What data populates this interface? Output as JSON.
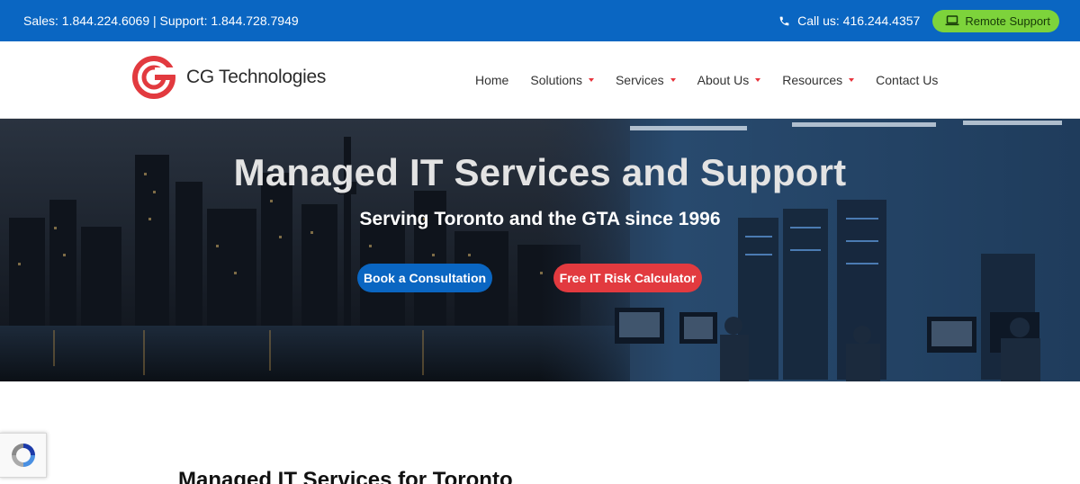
{
  "topbar": {
    "contact_text": "Sales: 1.844.224.6069 | Support: 1.844.728.7949",
    "call_text": "Call us: 416.244.4357",
    "remote_support_label": "Remote Support"
  },
  "header": {
    "logo_text": "CG Technologies",
    "nav": [
      {
        "label": "Home",
        "has_dropdown": false
      },
      {
        "label": "Solutions",
        "has_dropdown": true
      },
      {
        "label": "Services",
        "has_dropdown": true
      },
      {
        "label": "About Us",
        "has_dropdown": true
      },
      {
        "label": "Resources",
        "has_dropdown": true
      },
      {
        "label": "Contact Us",
        "has_dropdown": false
      }
    ]
  },
  "hero": {
    "title": "Managed IT Services and Support",
    "subtitle": "Serving Toronto and the GTA since 1996",
    "primary_button": "Book a Consultation",
    "secondary_button": "Free IT Risk Calculator"
  },
  "main": {
    "section_title": "Managed IT Services for Toronto"
  },
  "icons": {
    "phone": "phone-icon",
    "laptop": "laptop-icon",
    "logo": "cg-logo-icon",
    "recaptcha": "recaptcha-icon"
  },
  "colors": {
    "topbar": "#0a66c2",
    "accent_red": "#e23a3f",
    "remote_green": "#7dd33b"
  }
}
